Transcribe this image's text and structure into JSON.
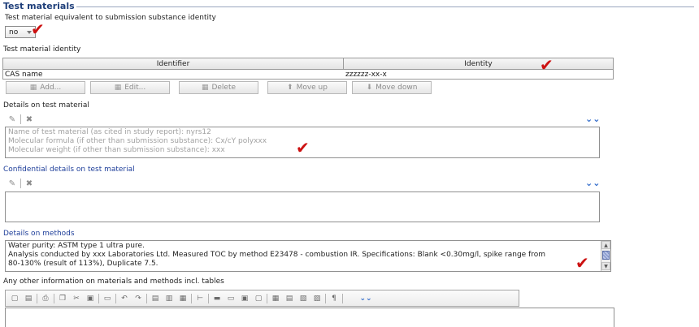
{
  "section": {
    "title": "Test materials"
  },
  "equivalence": {
    "label": "Test material equivalent to submission substance identity",
    "selected": "no"
  },
  "identity": {
    "label": "Test material identity",
    "columns": [
      "Identifier",
      "Identity"
    ],
    "rows": [
      {
        "identifier": "CAS name",
        "identity": "zzzzzz-xx-x"
      }
    ],
    "buttons": {
      "add": "Add...",
      "edit": "Edit...",
      "delete": "Delete",
      "move_up": "Move up",
      "move_down": "Move down"
    }
  },
  "details_test_material": {
    "label": "Details on test material",
    "lines": [
      "Name of test material (as cited in study report): nyrs12",
      "Molecular formula (if other than submission substance): Cx/cY polyxxx",
      "Molecular weight (if other than submission substance): xxx"
    ]
  },
  "confidential": {
    "label": "Confidential details on test material",
    "text": ""
  },
  "methods": {
    "label": "Details on methods",
    "lines": [
      "Water purity: ASTM type 1 ultra pure.",
      "Analysis conducted by xxx Laboratories Ltd.  Measured TOC by method E23478 - combustion IR.  Specifications: Blank <0.30mg/l, spike range from",
      "80-130% (result of 113%), Duplicate 7.5."
    ]
  },
  "other_info": {
    "label": "Any other information on materials and methods incl. tables"
  },
  "icons": {
    "check": "✔",
    "expand": "⌄⌄",
    "pen": "✎",
    "close_x": "✖"
  },
  "colors": {
    "section_title": "#1f3f7a",
    "blue_label": "#1f3f9a",
    "check_mark": "#cc1111",
    "expand_icon": "#2a66c9"
  }
}
